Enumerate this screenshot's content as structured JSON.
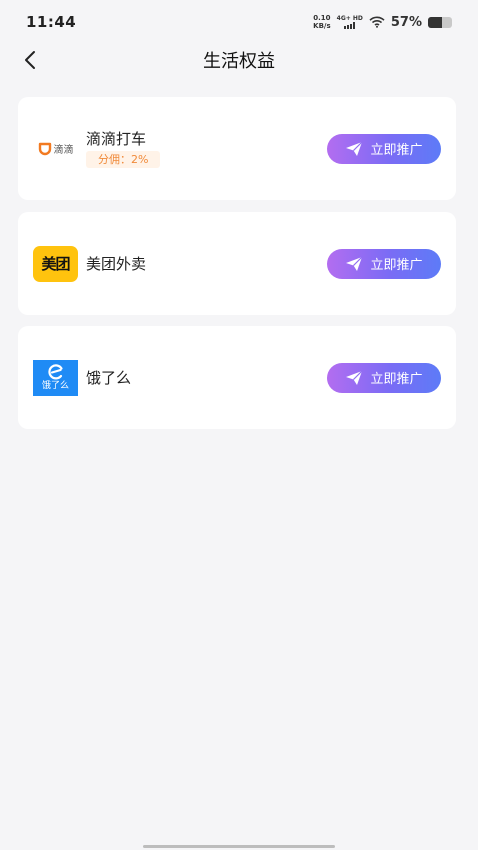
{
  "status_bar": {
    "time": "11:44",
    "net_speed_value": "0.10",
    "net_speed_unit": "KB/s",
    "signal_label": "4G+ HD",
    "battery_percent": "57%",
    "battery_level": 0.57
  },
  "nav": {
    "title": "生活权益"
  },
  "items": [
    {
      "name": "滴滴打车",
      "logo_text": "滴滴",
      "commission": "分佣：2%",
      "button_label": "立即推广"
    },
    {
      "name": "美团外卖",
      "logo_text": "美团",
      "button_label": "立即推广"
    },
    {
      "name": "饿了么",
      "logo_text": "饿了么",
      "button_label": "立即推广"
    }
  ],
  "colors": {
    "accent_start": "#b36df0",
    "accent_end": "#5d7bf7",
    "commission_text": "#f08a3a",
    "didi_orange": "#f27a21",
    "meituan_yellow": "#ffc30e",
    "eleme_blue": "#1f8bf5"
  }
}
